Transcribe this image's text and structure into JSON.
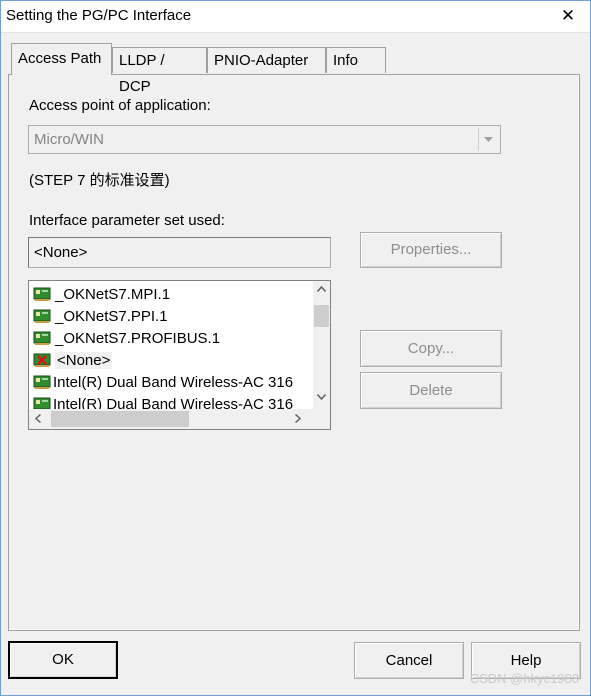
{
  "window": {
    "title": "Setting the PG/PC Interface",
    "close_glyph": "✕"
  },
  "tabs": [
    {
      "label": "Access Path",
      "active": true
    },
    {
      "label": "LLDP / DCP",
      "active": false
    },
    {
      "label": "PNIO-Adapter",
      "active": false
    },
    {
      "label": "Info",
      "active": false
    }
  ],
  "access_point": {
    "label": "Access point of application:",
    "value": "Micro/WIN",
    "note": "(STEP 7 的标准设置)"
  },
  "interface": {
    "label": "Interface parameter set used:",
    "value": "<None>",
    "properties_label": "Properties..."
  },
  "list": {
    "items": [
      {
        "label": "_OKNetS7.MPI.1",
        "icon": "network-card-icon",
        "selected": false
      },
      {
        "label": "_OKNetS7.PPI.1",
        "icon": "network-card-icon",
        "selected": false
      },
      {
        "label": "_OKNetS7.PROFIBUS.1",
        "icon": "network-card-icon",
        "selected": false
      },
      {
        "label": "<None>",
        "icon": "none-red-x-icon",
        "selected": true
      },
      {
        "label": "Intel(R) Dual Band Wireless-AC 316",
        "icon": "network-card-icon",
        "selected": false
      },
      {
        "label": "Intel(R) Dual Band Wireless-AC 316",
        "icon": "network-card-icon",
        "selected": false
      }
    ]
  },
  "side_buttons": {
    "copy_label": "Copy...",
    "delete_label": "Delete"
  },
  "footer": {
    "ok_label": "OK",
    "cancel_label": "Cancel",
    "help_label": "Help"
  },
  "watermark": "CSDN @hkyc1988"
}
